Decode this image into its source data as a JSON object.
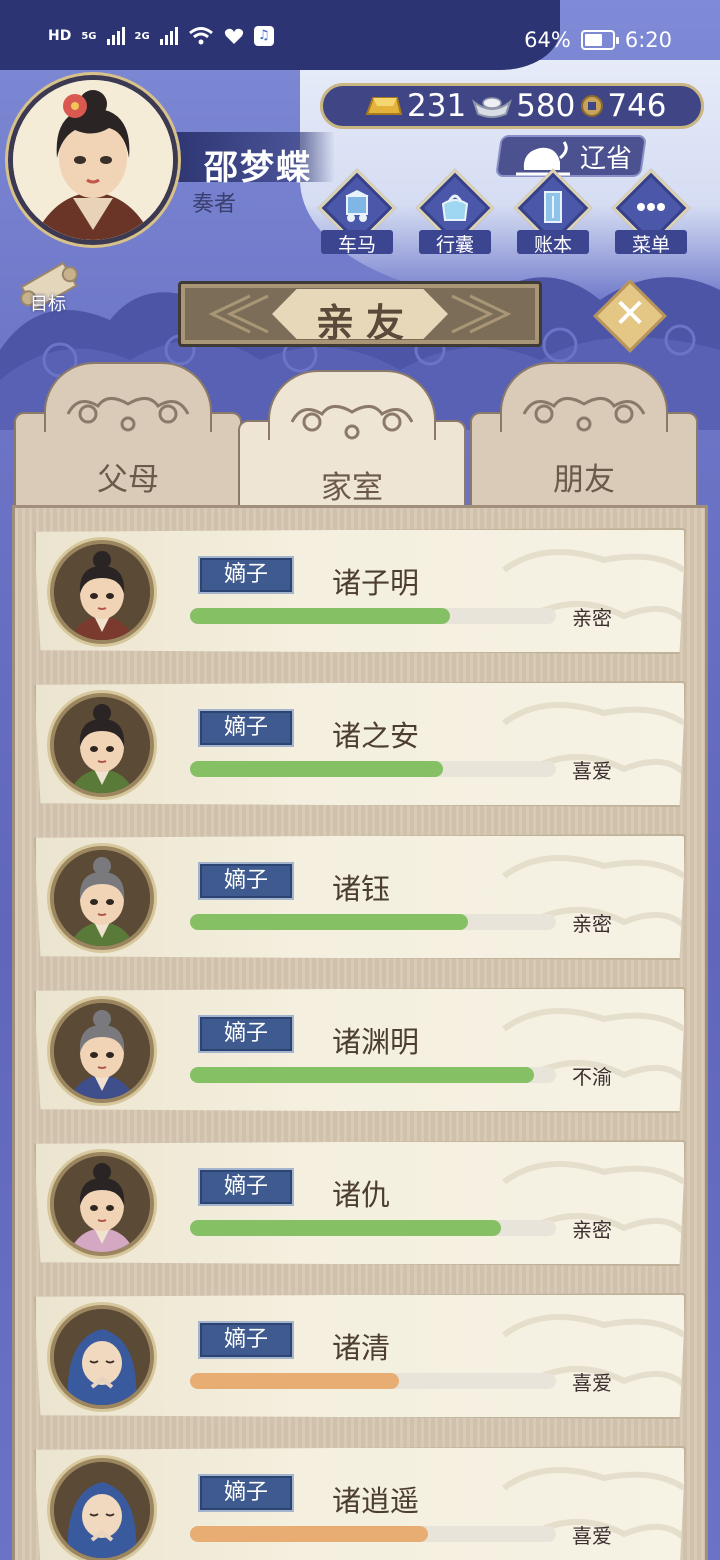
{
  "status_bar": {
    "hd": "HD",
    "net1": "5G",
    "net2": "2G",
    "battery_percent": "64%",
    "battery_level": 0.64,
    "time": "6:20"
  },
  "player": {
    "name": "邵梦蝶",
    "title": "奏者"
  },
  "currencies": {
    "gold": "231",
    "silver": "580",
    "coins": "746"
  },
  "location_button": "辽省",
  "menu": [
    {
      "label": "车马",
      "icon": "carriage-icon"
    },
    {
      "label": "行囊",
      "icon": "bag-icon"
    },
    {
      "label": "账本",
      "icon": "ledger-icon"
    },
    {
      "label": "菜单",
      "icon": "more-icon"
    }
  ],
  "goal_label": "目标",
  "page_title": "亲友",
  "tabs": [
    {
      "label": "父母",
      "active": false
    },
    {
      "label": "家室",
      "active": true
    },
    {
      "label": "朋友",
      "active": false
    }
  ],
  "colors": {
    "bar_green": "#86c065",
    "bar_orange": "#e8ad72"
  },
  "relatives": [
    {
      "rank": "嫡子",
      "name": "诸子明",
      "relation": "亲密",
      "affinity": 0.71,
      "bar": "green",
      "look": "topknot-young"
    },
    {
      "rank": "嫡子",
      "name": "诸之安",
      "relation": "喜爱",
      "affinity": 0.69,
      "bar": "green",
      "look": "topknot-boy"
    },
    {
      "rank": "嫡子",
      "name": "诸钰",
      "relation": "亲密",
      "affinity": 0.76,
      "bar": "green",
      "look": "grey-bun"
    },
    {
      "rank": "嫡子",
      "name": "诸渊明",
      "relation": "不渝",
      "affinity": 0.94,
      "bar": "green",
      "look": "grey-bun-blue"
    },
    {
      "rank": "嫡子",
      "name": "诸仇",
      "relation": "亲密",
      "affinity": 0.85,
      "bar": "green",
      "look": "topknot-pink"
    },
    {
      "rank": "嫡子",
      "name": "诸清",
      "relation": "喜爱",
      "affinity": 0.57,
      "bar": "orange",
      "look": "hooded-elder"
    },
    {
      "rank": "嫡子",
      "name": "诸逍遥",
      "relation": "喜爱",
      "affinity": 0.65,
      "bar": "orange",
      "look": "hooded-elder"
    }
  ]
}
